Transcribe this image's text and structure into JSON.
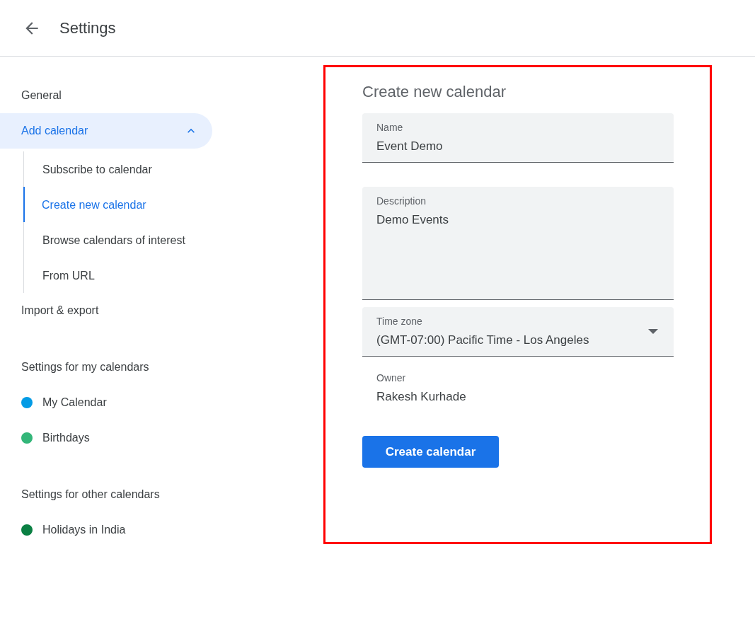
{
  "header": {
    "title": "Settings"
  },
  "sidebar": {
    "items": [
      {
        "label": "General",
        "selected": false
      },
      {
        "label": "Add calendar",
        "selected": false,
        "expanded": true,
        "children": [
          {
            "label": "Subscribe to calendar",
            "selected": false
          },
          {
            "label": "Create new calendar",
            "selected": true
          },
          {
            "label": "Browse calendars of interest",
            "selected": false
          },
          {
            "label": "From URL",
            "selected": false
          }
        ]
      },
      {
        "label": "Import & export",
        "selected": false
      }
    ],
    "sections": [
      {
        "title": "Settings for my calendars",
        "calendars": [
          {
            "name": "My Calendar",
            "color": "#039be5"
          },
          {
            "name": "Birthdays",
            "color": "#33b679"
          }
        ]
      },
      {
        "title": "Settings for other calendars",
        "calendars": [
          {
            "name": "Holidays in India",
            "color": "#0b8043"
          }
        ]
      }
    ]
  },
  "form": {
    "title": "Create new calendar",
    "fields": [
      {
        "kind": "text",
        "label": "Name",
        "value": "Event Demo"
      },
      {
        "kind": "textarea",
        "label": "Description",
        "value": "Demo Events"
      },
      {
        "kind": "select",
        "label": "Time zone",
        "value": "(GMT-07:00) Pacific Time - Los Angeles"
      },
      {
        "kind": "static",
        "label": "Owner",
        "value": "Rakesh Kurhade"
      }
    ],
    "button": "Create calendar"
  }
}
